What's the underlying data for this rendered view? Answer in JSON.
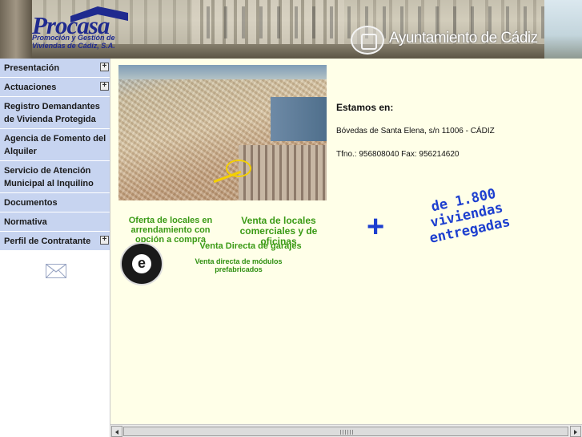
{
  "header": {
    "logo_name": "Procasa",
    "logo_subtitle": "Promoción y Gestión de\nViviendas de Cádiz, S.A.",
    "ayuntamiento": "Ayuntamiento de Cádiz"
  },
  "sidebar": {
    "items": [
      {
        "label": "Presentación",
        "expandable": true
      },
      {
        "label": "Actuaciones",
        "expandable": true
      },
      {
        "label": "Registro Demandantes de Vivienda Protegida",
        "expandable": false
      },
      {
        "label": "Agencia de Fomento del Alquiler",
        "expandable": false
      },
      {
        "label": "Servicio de Atención Municipal al Inquilino",
        "expandable": false
      },
      {
        "label": "Documentos",
        "expandable": false
      },
      {
        "label": "Normativa",
        "expandable": false
      },
      {
        "label": "Perfil de Contratante",
        "expandable": true
      }
    ],
    "expand_symbol": "+",
    "mail_icon": "envelope-icon"
  },
  "main": {
    "info_title": "Estamos en:",
    "address": "Bóvedas de Santa Elena, s/n 11006 - CÁDIZ",
    "phone": "Tfno.: 956808040 Fax: 956214620",
    "banner_oferta": "Oferta de locales en arrendamiento con opción a compra",
    "banner_venta_locales": "Venta de locales comerciales y de oficinas",
    "banner_garajes": "Venta Directa de garajes",
    "banner_modulos": "Venta directa de módulos prefabricados",
    "badge_letter": "e",
    "plus_symbol": "+",
    "viviendas_text": "de 1.800 viviendas entregadas"
  },
  "colors": {
    "page_background": "#ffffe8",
    "menu_background": "#c7d4f0",
    "brand_blue": "#1f2a8f",
    "green_text": "#3a9a15",
    "highlight_blue": "#1d3fcf"
  }
}
